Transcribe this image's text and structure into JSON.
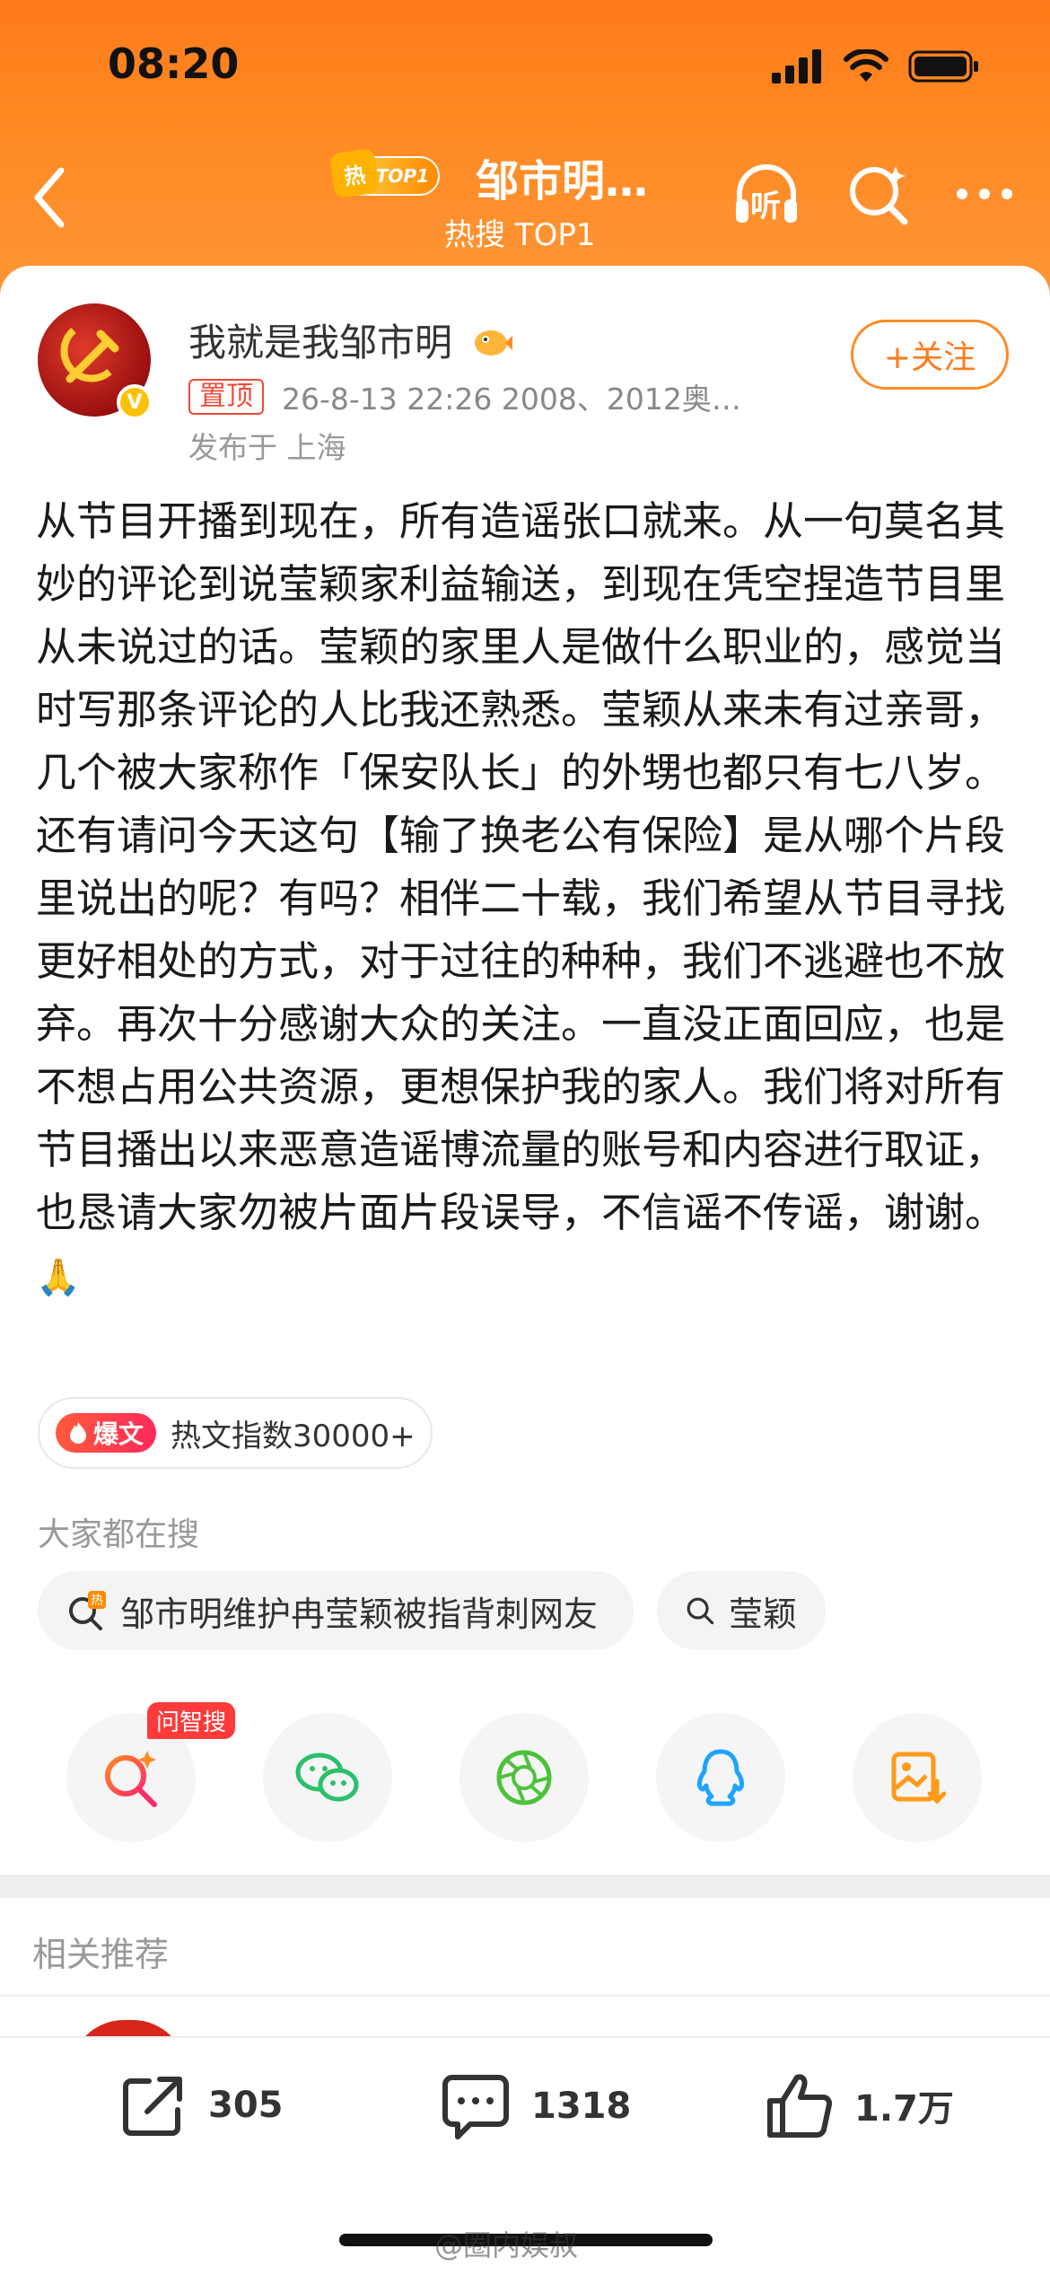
{
  "status_bar": {
    "time": "08:20"
  },
  "nav": {
    "hot_badge": "热",
    "top_badge": "TOP1",
    "title": "邹市明…",
    "subtitle": "热搜 TOP1",
    "listen_label": "听"
  },
  "post": {
    "author": "我就是我邹市明",
    "pin_tag": "置顶",
    "meta": "26-8-13 22:26  2008、2012奥…",
    "location": "发布于 上海",
    "follow_label": "+关注",
    "body": "从节目开播到现在，所有造谣张口就来。从一句莫名其妙的评论到说莹颖家利益输送，到现在凭空捏造节目里从未说过的话。莹颖的家里人是做什么职业的，感觉当时写那条评论的人比我还熟悉。莹颖从来未有过亲哥，几个被大家称作「保安队长」的外甥也都只有七八岁。还有请问今天这句【输了换老公有保险】是从哪个片段里说出的呢？有吗？相伴二十载，我们希望从节目寻找更好相处的方式，对于过往的种种，我们不逃避也不放弃。再次十分感谢大众的关注。一直没正面回应，也是不想占用公共资源，更想保护我的家人。我们将对所有节目播出以来恶意造谣博流量的账号和内容进行取证，也恳请大家勿被片面片段误导，不信谣不传谣，谢谢。",
    "emoji": "🙏"
  },
  "hot_index": {
    "tag": "爆文",
    "text": "热文指数30000+"
  },
  "searching": {
    "label": "大家都在搜",
    "chips": [
      {
        "text": "邹市明维护冉莹颖被指背刺网友",
        "icon": "hot-search-icon"
      },
      {
        "text": "莹颖",
        "icon": "search-icon"
      }
    ]
  },
  "share": {
    "ai_badge": "问智搜",
    "items": [
      "ai-search-icon",
      "wechat-icon",
      "moments-icon",
      "qq-icon",
      "save-image-icon"
    ]
  },
  "related": {
    "label": "相关推荐"
  },
  "actions": {
    "repost": "305",
    "comment": "1318",
    "like": "1.7万"
  },
  "watermark": "@圈内娱叔",
  "colors": {
    "header": "#ff7a1a",
    "accent": "#ff8a24",
    "pin": "#f24a3a"
  }
}
